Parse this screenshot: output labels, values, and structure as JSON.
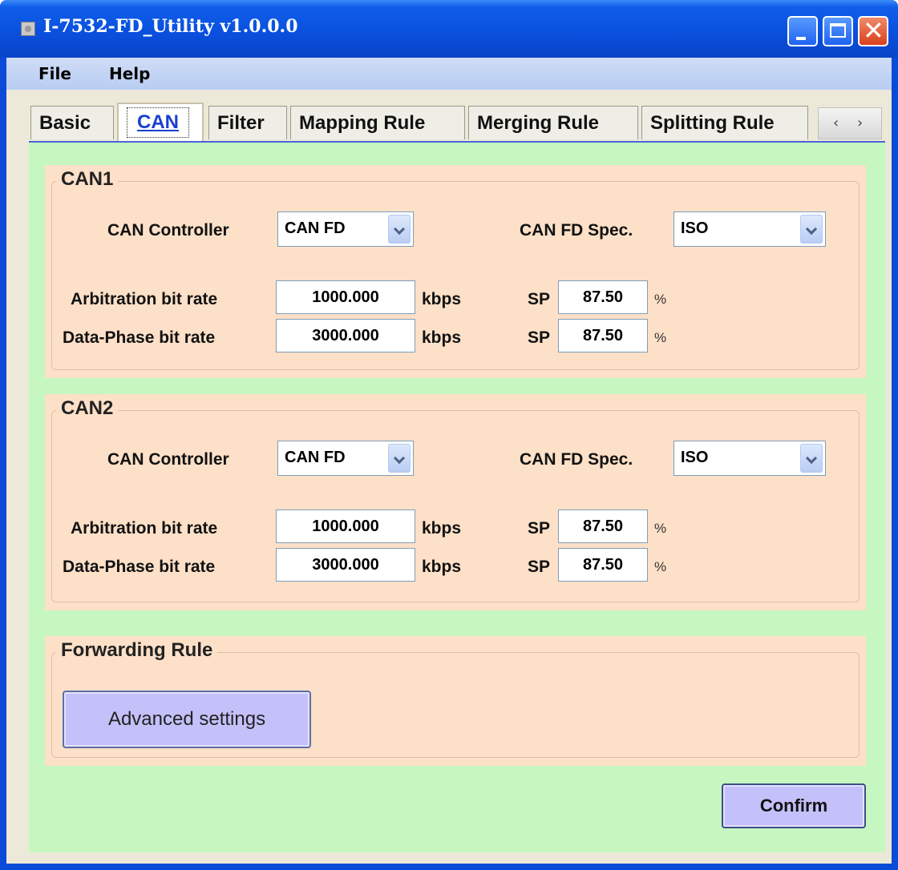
{
  "window": {
    "title": "I-7532-FD_Utility v1.0.0.0",
    "icons": {
      "app": "app-icon",
      "minimize": "minimize-icon",
      "maximize": "maximize-icon",
      "close": "close-icon"
    },
    "close_glyph": "✕"
  },
  "menu": {
    "file": "File",
    "help": "Help"
  },
  "tabs": {
    "basic": "Basic",
    "can": "CAN",
    "filter": "Filter",
    "mapping": "Mapping Rule",
    "merging": "Merging Rule",
    "splitting": "Splitting Rule",
    "scroll_left": "‹",
    "scroll_right": "›"
  },
  "can1": {
    "title": "CAN1",
    "controller_label": "CAN Controller",
    "controller_value": "CAN FD",
    "spec_label": "CAN FD Spec.",
    "spec_value": "ISO",
    "arb_label": "Arbitration bit rate",
    "arb_value": "1000.000",
    "arb_unit": "kbps",
    "arb_sp_label": "SP",
    "arb_sp_value": "87.50",
    "arb_sp_unit": "%",
    "data_label": "Data-Phase bit rate",
    "data_value": "3000.000",
    "data_unit": "kbps",
    "data_sp_label": "SP",
    "data_sp_value": "87.50",
    "data_sp_unit": "%"
  },
  "can2": {
    "title": "CAN2",
    "controller_label": "CAN Controller",
    "controller_value": "CAN FD",
    "spec_label": "CAN FD Spec.",
    "spec_value": "ISO",
    "arb_label": "Arbitration bit rate",
    "arb_value": "1000.000",
    "arb_unit": "kbps",
    "arb_sp_label": "SP",
    "arb_sp_value": "87.50",
    "arb_sp_unit": "%",
    "data_label": "Data-Phase bit rate",
    "data_value": "3000.000",
    "data_unit": "kbps",
    "data_sp_label": "SP",
    "data_sp_value": "87.50",
    "data_sp_unit": "%"
  },
  "forwarding": {
    "title": "Forwarding Rule",
    "advanced_button": "Advanced settings"
  },
  "confirm_button": "Confirm",
  "colors": {
    "titlebar": "#0a50df",
    "panel_background": "#c6f7c0",
    "group_background": "#fde0c8",
    "button_background": "#c3c0fa",
    "active_tab_text": "#1a3fd0"
  }
}
